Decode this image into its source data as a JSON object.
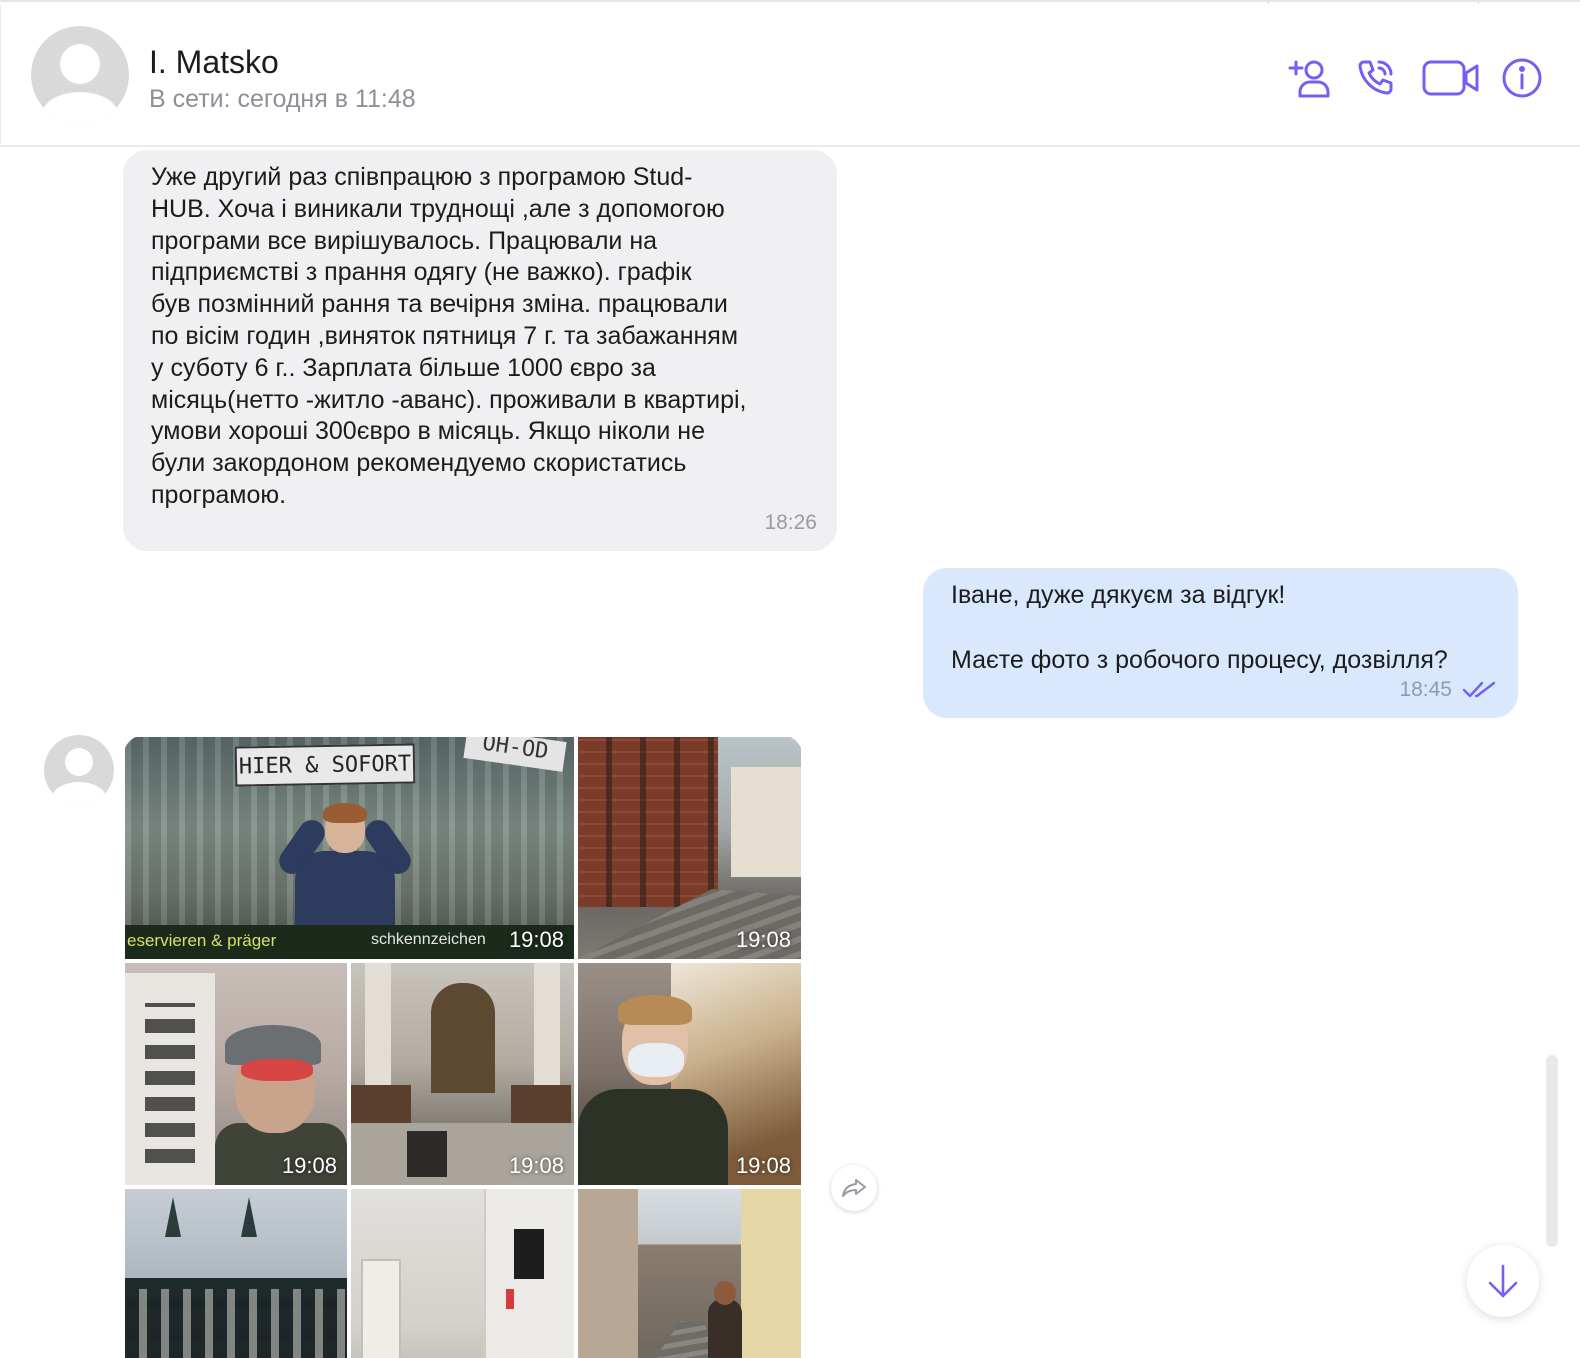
{
  "header": {
    "contact_name": "I. Matsko",
    "status": "В сети: сегодня в 11:48",
    "actions": {
      "add_participant_icon": "add-user-icon",
      "voice_call_icon": "phone-icon",
      "video_call_icon": "video-camera-icon",
      "info_icon": "info-icon"
    }
  },
  "messages": {
    "incoming_1": {
      "text": "Уже другий раз співпрацюю з програмою Stud-\nHUB. Хоча і виникали труднощі ,але з допомогою\nпрограми все вирішувалось. Працювали на\nпідприємстві з прання одягу (не важко).   графік\nбув позмінний рання та вечірня зміна. працювали\nпо вісім годин ,виняток пятниця 7 г. та забажанням\nу суботу 6 г.. Зарплата більше 1000 євро за\nмісяць(нетто -житло -аванс). проживали в квартирі,\nумови хороші 300євро в місяць. Якщо ніколи не\nбули закордоном рекомендуемо скористатись\nпрограмою.",
      "time": "18:26"
    },
    "outgoing_1": {
      "line1": "Іване, дуже дякуєм за відгук!",
      "line2": "Маєте фото з робочого процесу, дозвілля?",
      "time": "18:45",
      "status_icon": "double-check-icon"
    },
    "gallery": {
      "photos": [
        {
          "time": "19:08",
          "sign_text": "HIER & SOFORT",
          "sign_text_2": "OH-OD",
          "strip_left": "eservieren & präger",
          "strip_right": "schkennzeichen"
        },
        {
          "time": "19:08"
        },
        {
          "time": "19:08"
        },
        {
          "time": "19:08"
        },
        {
          "time": "19:08"
        }
      ]
    }
  },
  "controls": {
    "share_icon": "share-arrow-icon",
    "scroll_down_icon": "arrow-down-icon"
  },
  "colors": {
    "accent": "#7360f2",
    "incoming_bubble": "#f0f0f2",
    "outgoing_bubble": "#d9e8fd",
    "muted_text": "#8f8f98"
  }
}
